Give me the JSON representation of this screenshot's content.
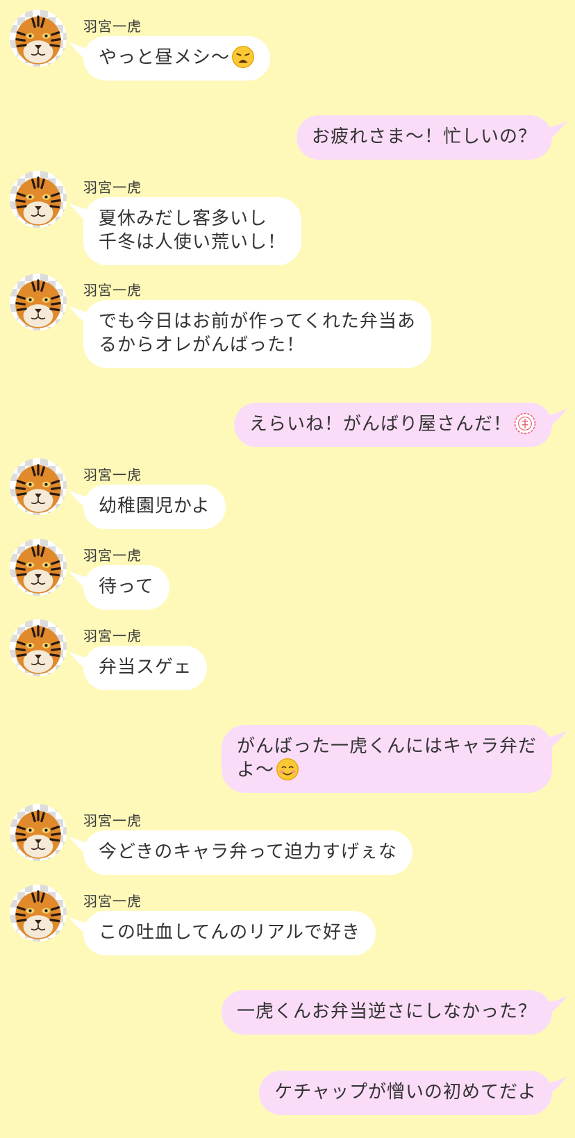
{
  "sender": "羽宮一虎",
  "messages": [
    {
      "side": "in",
      "name": "羽宮一虎",
      "text": "やっと昼メシ〜",
      "emoji": "weary-face-emoji"
    },
    {
      "side": "out",
      "text": "お疲れさま〜！忙しいの？"
    },
    {
      "side": "in",
      "name": "羽宮一虎",
      "text": "夏休みだし客多いし\n千冬は人使い荒いし！"
    },
    {
      "side": "in",
      "name": "羽宮一虎",
      "text": "でも今日はお前が作ってくれた弁当あ\nるからオレがんばった！"
    },
    {
      "side": "out",
      "text": "えらいね！がんばり屋さんだ！",
      "emoji": "flower-stamp-emoji"
    },
    {
      "side": "in",
      "name": "羽宮一虎",
      "text": "幼稚園児かよ"
    },
    {
      "side": "in",
      "name": "羽宮一虎",
      "text": "待って"
    },
    {
      "side": "in",
      "name": "羽宮一虎",
      "text": "弁当スゲェ"
    },
    {
      "side": "out",
      "text": "がんばった一虎くんにはキャラ弁だ\nよ〜",
      "emoji": "smiling-face-emoji"
    },
    {
      "side": "in",
      "name": "羽宮一虎",
      "text": "今どきのキャラ弁って迫力すげぇな"
    },
    {
      "side": "in",
      "name": "羽宮一虎",
      "text": "この吐血してんのリアルで好き"
    },
    {
      "side": "out",
      "text": "一虎くんお弁当逆さにしなかった？"
    },
    {
      "side": "out",
      "text": "ケチャップが憎いの初めてだよ"
    }
  ],
  "colors": {
    "background": "#fef9b9",
    "incoming_bubble": "#ffffff",
    "outgoing_bubble": "#fadcf8",
    "text": "#333333"
  },
  "avatar_icon": "tiger-avatar-icon"
}
